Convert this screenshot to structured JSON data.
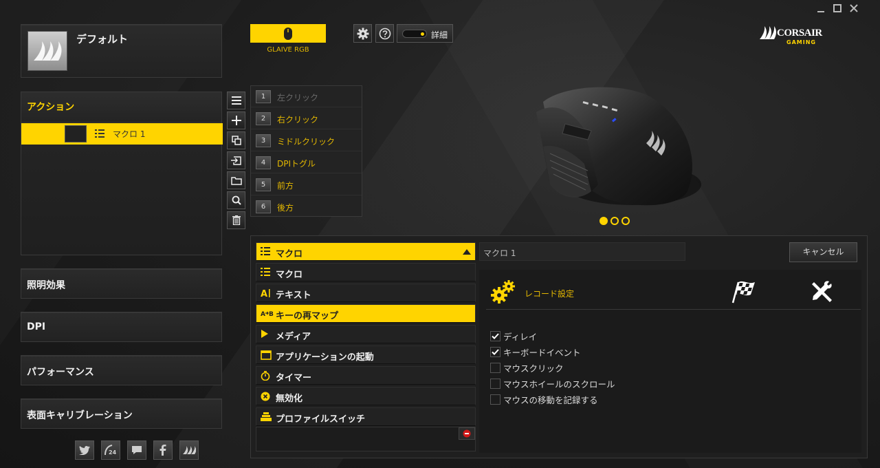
{
  "window": {
    "controls": [
      "minimize-icon",
      "maximize-icon",
      "close-icon"
    ]
  },
  "profile": {
    "name": "デフォルト"
  },
  "actions": {
    "header": "アクション",
    "items": [
      {
        "label": "マクロ 1"
      }
    ]
  },
  "sections": [
    {
      "label": "照明効果"
    },
    {
      "label": "DPI"
    },
    {
      "label": "パフォーマンス"
    },
    {
      "label": "表面キャリブレーション"
    }
  ],
  "social": [
    "twitter-icon",
    "support-24-icon",
    "chat-icon",
    "facebook-icon",
    "corsair-sails-icon"
  ],
  "device": {
    "name": "GLAIVE RGB"
  },
  "top_buttons": {
    "settings": "gear-icon",
    "help": "help-icon",
    "detail_label": "詳細"
  },
  "brand": {
    "name": "CORSAIR",
    "sub": "GAMING"
  },
  "keys": [
    {
      "num": "1",
      "label": "左クリック",
      "enabled": false
    },
    {
      "num": "2",
      "label": "右クリック",
      "enabled": true
    },
    {
      "num": "3",
      "label": "ミドルクリック",
      "enabled": true
    },
    {
      "num": "4",
      "label": "DPIトグル",
      "enabled": true
    },
    {
      "num": "5",
      "label": "前方",
      "enabled": true
    },
    {
      "num": "6",
      "label": "後方",
      "enabled": true
    }
  ],
  "carousel": {
    "count": 3,
    "active": 0
  },
  "editor": {
    "selected_type": "マクロ",
    "types": [
      {
        "label": "マクロ",
        "icon": "list-icon"
      },
      {
        "label": "テキスト",
        "icon": "text-icon"
      },
      {
        "label": "キーの再マップ",
        "icon": "remap-icon",
        "highlight": true
      },
      {
        "label": "メディア",
        "icon": "play-icon"
      },
      {
        "label": "アプリケーションの起動",
        "icon": "window-icon"
      },
      {
        "label": "タイマー",
        "icon": "timer-icon"
      },
      {
        "label": "無効化",
        "icon": "disable-icon"
      },
      {
        "label": "プロファイルスイッチ",
        "icon": "profile-switch-icon"
      }
    ],
    "name_value": "マクロ 1",
    "cancel_label": "キャンセル",
    "record_settings_label": "レコード設定",
    "options": [
      {
        "label": "ディレイ",
        "checked": true
      },
      {
        "label": "キーボードイベント",
        "checked": true
      },
      {
        "label": "マウスクリック",
        "checked": false
      },
      {
        "label": "マウスホイールのスクロール",
        "checked": false
      },
      {
        "label": "マウスの移動を記録する",
        "checked": false
      }
    ]
  },
  "colors": {
    "accent": "#ffd400",
    "panel": "#262626",
    "text": "#e6e6e6"
  }
}
